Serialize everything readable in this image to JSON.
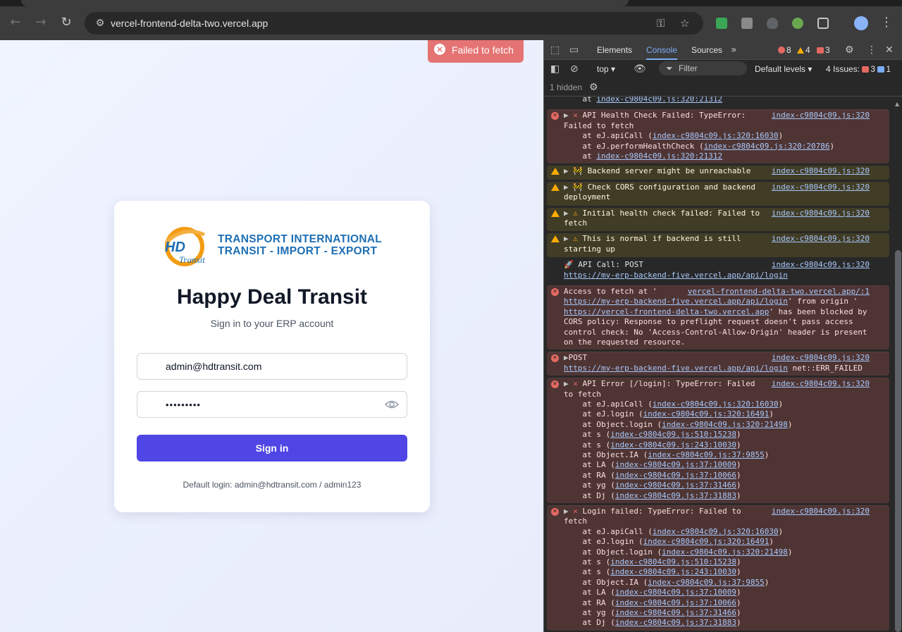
{
  "browser": {
    "url": "vercel-frontend-delta-two.vercel.app",
    "icons": [
      "back-icon",
      "forward-icon",
      "reload-icon",
      "site-settings-icon",
      "key-icon",
      "star-icon",
      "extensions-icon",
      "profile-icon",
      "menu-icon"
    ]
  },
  "page": {
    "toast": "Failed to fetch",
    "logo_line1": "TRANSPORT INTERNATIONAL",
    "logo_line2": "TRANSIT - IMPORT - EXPORT",
    "logo_mark": "HD",
    "logo_script": "Transit",
    "title": "Happy Deal Transit",
    "subtitle": "Sign in to your ERP account",
    "email_value": "admin@hdtransit.com",
    "password_value": "•••••••••",
    "signin_label": "Sign in",
    "hint": "Default login: admin@hdtransit.com / admin123"
  },
  "devtools": {
    "tabs": [
      "Elements",
      "Console",
      "Sources"
    ],
    "active_tab": "Console",
    "errors": "8",
    "warnings": "4",
    "issues_count": "3",
    "context": "top",
    "filter_placeholder": "Filter",
    "levels": "Default levels",
    "issues_label": "4 Issues:",
    "issues_red": "3",
    "issues_blue": "1",
    "hidden": "1 hidden",
    "messages": [
      {
        "type": "info",
        "text": "    at ",
        "link": "index-c9804c09.js:320:21312"
      },
      {
        "type": "err",
        "head": "▶ ✕ API Health Check Failed: TypeError:",
        "src": "index-c9804c09.js:320",
        "lines": [
          "Failed to fetch",
          "    at eJ.apiCall (index-c9804c09.js:320:16030)",
          "    at eJ.performHealthCheck (index-c9804c09.js:320:20786)",
          "    at index-c9804c09.js:320:21312"
        ]
      },
      {
        "type": "warn",
        "head": "▶ 🚧 Backend server might be unreachable",
        "src": "index-c9804c09.js:320",
        "lines": []
      },
      {
        "type": "warn",
        "head": "▶ 🚧 Check CORS configuration and backend",
        "src": "index-c9804c09.js:320",
        "lines": [
          "deployment"
        ]
      },
      {
        "type": "warn",
        "head": "▶ ⚠ Initial health check failed: Failed to",
        "src": "index-c9804c09.js:320",
        "lines": [
          "fetch"
        ]
      },
      {
        "type": "warn",
        "head": "▶ ⚠ This is normal if backend is still",
        "src": "index-c9804c09.js:320",
        "lines": [
          "starting up"
        ]
      },
      {
        "type": "info",
        "head": "🚀 API Call: POST",
        "src": "index-c9804c09.js:320",
        "lines": [
          "https://my-erp-backend-five.vercel.app/api/login"
        ]
      },
      {
        "type": "err",
        "head": "Access to fetch at '",
        "src": "vercel-frontend-delta-two.vercel.app/:1",
        "lines": [
          "https://my-erp-backend-five.vercel.app/api/login' from origin '",
          "https://vercel-frontend-delta-two.vercel.app' has been blocked by",
          "CORS policy: Response to preflight request doesn't pass access",
          "control check: No 'Access-Control-Allow-Origin' header is present",
          "on the requested resource."
        ]
      },
      {
        "type": "err",
        "head": "▶POST",
        "src": "index-c9804c09.js:320",
        "lines": [
          "https://my-erp-backend-five.vercel.app/api/login net::ERR_FAILED"
        ]
      },
      {
        "type": "err",
        "head": "▶ ✕ API Error [/login]: TypeError: Failed",
        "src": "index-c9804c09.js:320",
        "lines": [
          "to fetch",
          "    at eJ.apiCall (index-c9804c09.js:320:16030)",
          "    at eJ.login (index-c9804c09.js:320:16491)",
          "    at Object.login (index-c9804c09.js:320:21498)",
          "    at s (index-c9804c09.js:510:15238)",
          "    at s (index-c9804c09.js:243:10030)",
          "    at Object.IA (index-c9804c09.js:37:9855)",
          "    at LA (index-c9804c09.js:37:10009)",
          "    at RA (index-c9804c09.js:37:10066)",
          "    at yg (index-c9804c09.js:37:31466)",
          "    at Dj (index-c9804c09.js:37:31883)"
        ]
      },
      {
        "type": "err",
        "head": "▶ ✕ Login failed: TypeError: Failed to",
        "src": "index-c9804c09.js:320",
        "lines": [
          "fetch",
          "    at eJ.apiCall (index-c9804c09.js:320:16030)",
          "    at eJ.login (index-c9804c09.js:320:16491)",
          "    at Object.login (index-c9804c09.js:320:21498)",
          "    at s (index-c9804c09.js:510:15238)",
          "    at s (index-c9804c09.js:243:10030)",
          "    at Object.IA (index-c9804c09.js:37:9855)",
          "    at LA (index-c9804c09.js:37:10009)",
          "    at RA (index-c9804c09.js:37:10066)",
          "    at yg (index-c9804c09.js:37:31466)",
          "    at Dj (index-c9804c09.js:37:31883)"
        ]
      }
    ]
  }
}
